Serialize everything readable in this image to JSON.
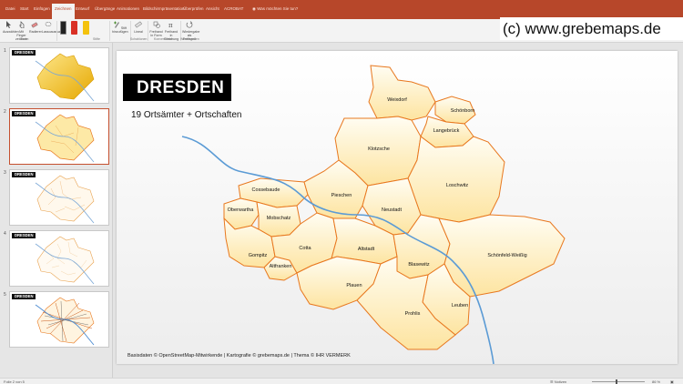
{
  "ribbon_tabs": [
    {
      "label": "Datei",
      "active": false
    },
    {
      "label": "Start",
      "active": false
    },
    {
      "label": "Einfügen",
      "active": false
    },
    {
      "label": "Zeichnen",
      "active": true
    },
    {
      "label": "Entwurf",
      "active": false
    },
    {
      "label": "Übergänge",
      "active": false
    },
    {
      "label": "Animationen",
      "active": false
    },
    {
      "label": "Bildschirmpräsentation",
      "active": false
    },
    {
      "label": "Überprüfen",
      "active": false
    },
    {
      "label": "Ansicht",
      "active": false
    },
    {
      "label": "ACROBAT",
      "active": false
    }
  ],
  "tell_me": "Was möchten Sie tun?",
  "ribbon": {
    "select_label": "Auswählen",
    "finger_label": "Mit Finger zeichnen",
    "eraser_label": "Radierer",
    "lasso_label": "Lassoauswahl",
    "tools_group": "Tools",
    "pens_group": "Stifte",
    "add_pen_label": "Stift hinzufügen",
    "ruler_label": "Lineal",
    "ink_to_shape_label": "Freihand in Form",
    "ink_to_math_label": "Freihand in Gleichung",
    "replay_label": "Wiedergabe als Freihand",
    "templates_group": "Schablonen",
    "convert_group": "Konvertieren",
    "playback_group": "Wiedergeben"
  },
  "watermark": "(c) www.grebemaps.de",
  "thumbnails": [
    {
      "number": "1",
      "title": "DRESDEN"
    },
    {
      "number": "2",
      "title": "DRESDEN"
    },
    {
      "number": "3",
      "title": "DRESDEN"
    },
    {
      "number": "4",
      "title": "DRESDEN"
    },
    {
      "number": "5",
      "title": "DRESDEN"
    }
  ],
  "slide": {
    "title": "DRESDEN",
    "subtitle": "19 Ortsämter + Ortschaften",
    "footer": "Basisdaten © OpenStreetMap-Mitwirkende | Kartografie © grebemaps.de | Thema © IHR VERMERK"
  },
  "districts": [
    "Weixdorf",
    "Schönborn",
    "Langebrück",
    "Klotzsche",
    "Loschwitz",
    "Cossebaude",
    "Oberwartha",
    "Mobschatz",
    "Pieschen",
    "Neustadt",
    "Gompitz",
    "Altfranken",
    "Cotta",
    "Altstadt",
    "Blasewitz",
    "Schönfeld-Weißig",
    "Plauen",
    "Leuben",
    "Prohlis"
  ],
  "status": {
    "slide_info": "Folie 2 von 5",
    "notes_label": "Notizen",
    "zoom": "86 %"
  },
  "colors": {
    "accent": "#b7472a",
    "map_fill": "#fde9a6",
    "map_border": "#e8781f",
    "river": "#5b9bd5"
  }
}
